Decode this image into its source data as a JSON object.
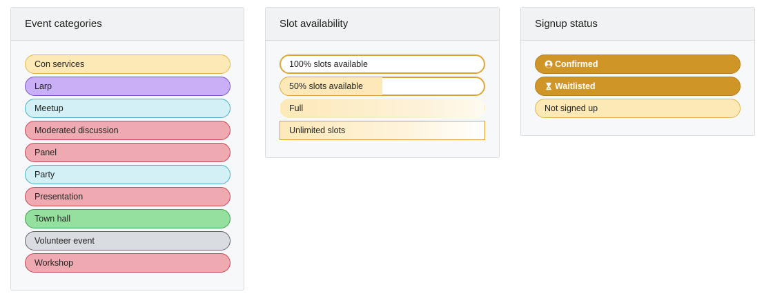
{
  "cards": {
    "categories": {
      "title": "Event categories",
      "items": [
        {
          "label": "Con services",
          "bg": "#fde9b6",
          "border": "#e0b64a"
        },
        {
          "label": "Larp",
          "bg": "#c9b0f6",
          "border": "#7b53c9"
        },
        {
          "label": "Meetup",
          "bg": "#d2f0f6",
          "border": "#42b0c8"
        },
        {
          "label": "Moderated discussion",
          "bg": "#efaab1",
          "border": "#c84652"
        },
        {
          "label": "Panel",
          "bg": "#efaab1",
          "border": "#c84652"
        },
        {
          "label": "Party",
          "bg": "#d2f0f6",
          "border": "#42b0c8"
        },
        {
          "label": "Presentation",
          "bg": "#efaab1",
          "border": "#c84652"
        },
        {
          "label": "Town hall",
          "bg": "#96e09f",
          "border": "#3ba24b"
        },
        {
          "label": "Volunteer event",
          "bg": "#d9dce0",
          "border": "#5f6469"
        },
        {
          "label": "Workshop",
          "bg": "#efaab1",
          "border": "#c84652"
        }
      ]
    },
    "availability": {
      "title": "Slot availability",
      "items": [
        {
          "label": "100% slots available",
          "available_fraction": 1.0
        },
        {
          "label": "50% slots available",
          "available_fraction": 0.5
        },
        {
          "label": "Full",
          "available_fraction": 0
        },
        {
          "label": "Unlimited slots",
          "available_fraction": 1.0
        }
      ],
      "colors": {
        "fill": "#fde9b8",
        "border": "#d7a32c",
        "empty": "#ffffff",
        "full_bg": "#fdf2d9"
      }
    },
    "signup": {
      "title": "Signup status",
      "items": [
        {
          "label": "Confirmed",
          "icon": "user-circle-icon"
        },
        {
          "label": "Waitlisted",
          "icon": "hourglass-icon"
        },
        {
          "label": "Not signed up",
          "icon": ""
        }
      ],
      "colors": {
        "accent": "#cf9627",
        "accent_border": "#b57f1d",
        "light_bg": "#fde9b6",
        "light_border": "#e0b64a"
      }
    }
  }
}
